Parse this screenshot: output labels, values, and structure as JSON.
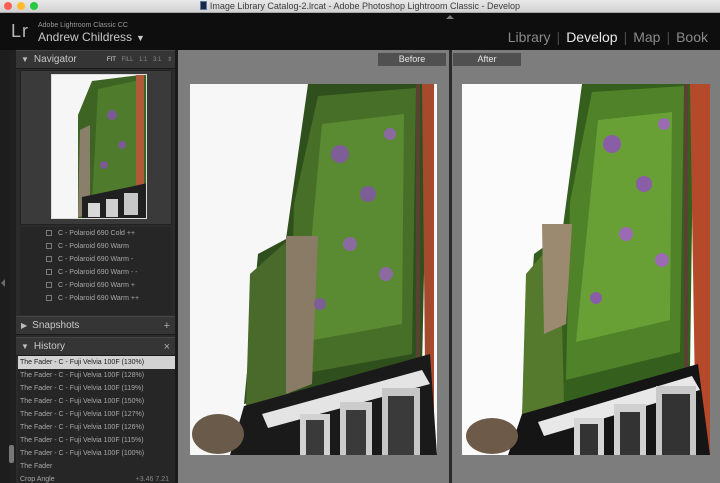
{
  "window": {
    "title": "Image Library Catalog-2.lrcat - Adobe Photoshop Lightroom Classic - Develop"
  },
  "identity": {
    "logo": "Lr",
    "product": "Adobe Lightroom Classic CC",
    "user": "Andrew Childress",
    "caret": "▼"
  },
  "modules": [
    "Library",
    "Develop",
    "Map",
    "Book"
  ],
  "navigator": {
    "title": "Navigator",
    "zoom": [
      "FIT",
      "FILL",
      "1:1",
      "3:1"
    ]
  },
  "presets": [
    "C - Polaroid 690 Cold ++",
    "C - Polaroid 690 Warm",
    "C - Polaroid 690 Warm -",
    "C - Polaroid 690 Warm - -",
    "C - Polaroid 690 Warm +",
    "C - Polaroid 690 Warm ++"
  ],
  "snapshots": {
    "title": "Snapshots",
    "plus": "+"
  },
  "history": {
    "title": "History",
    "close": "×",
    "items": [
      {
        "label": "The Fader - C - Fuji Velvia 100F (130%)",
        "vals": ""
      },
      {
        "label": "The Fader - C - Fuji Velvia 100F (128%)",
        "vals": ""
      },
      {
        "label": "The Fader - C - Fuji Velvia 100F (119%)",
        "vals": ""
      },
      {
        "label": "The Fader - C - Fuji Velvia 100F (150%)",
        "vals": ""
      },
      {
        "label": "The Fader - C - Fuji Velvia 100F (127%)",
        "vals": ""
      },
      {
        "label": "The Fader - C - Fuji Velvia 100F (126%)",
        "vals": ""
      },
      {
        "label": "The Fader - C - Fuji Velvia 100F (115%)",
        "vals": ""
      },
      {
        "label": "The Fader - C - Fuji Velvia 100F (100%)",
        "vals": ""
      },
      {
        "label": "The Fader",
        "vals": ""
      },
      {
        "label": "Crop Angle",
        "vals": "+3.46   7.21"
      }
    ]
  },
  "compare": {
    "before": "Before",
    "after": "After"
  },
  "colors": {
    "accent": "#e8e8e8",
    "panel": "#2b2b2b",
    "canvas": "#7d7d7d",
    "foliage": "#3f6a23",
    "flowers": "#8b6aa0"
  }
}
